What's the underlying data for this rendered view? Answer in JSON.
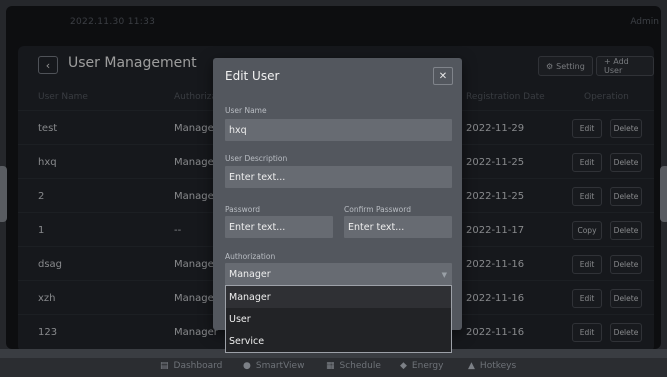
{
  "topbar": {
    "datetime": "2022.11.30   11:33",
    "user": "Admin"
  },
  "page": {
    "title": "User Management",
    "back_icon": "chevron-left-icon",
    "setting_label": "Setting",
    "add_user_label": "+ Add User"
  },
  "table": {
    "columns": [
      "User Name",
      "Authorizati",
      "Registration Date",
      "Operation"
    ],
    "rows": [
      {
        "name": "test",
        "auth": "Manager",
        "date": "2022-11-29",
        "btn1": "Edit",
        "btn2": "Delete"
      },
      {
        "name": "hxq",
        "auth": "Manager",
        "date": "2022-11-25",
        "btn1": "Edit",
        "btn2": "Delete"
      },
      {
        "name": "2",
        "auth": "Manager",
        "date": "2022-11-25",
        "btn1": "Edit",
        "btn2": "Delete"
      },
      {
        "name": "1",
        "auth": "--",
        "date": "2022-11-17",
        "btn1": "Copy",
        "btn2": "Delete"
      },
      {
        "name": "dsag",
        "auth": "Manager",
        "date": "2022-11-16",
        "btn1": "Edit",
        "btn2": "Delete"
      },
      {
        "name": "xzh",
        "auth": "Manager",
        "date": "2022-11-16",
        "btn1": "Edit",
        "btn2": "Delete"
      },
      {
        "name": "123",
        "auth": "Manager",
        "date": "2022-11-16",
        "btn1": "Edit",
        "btn2": "Delete"
      }
    ]
  },
  "dialog": {
    "title": "Edit User",
    "close_glyph": "✕",
    "username_label": "User Name",
    "username_value": "hxq",
    "description_label": "User Description",
    "description_placeholder": "Enter text...",
    "password_label": "Password",
    "password_placeholder": "Enter text...",
    "confirm_label": "Confirm Password",
    "confirm_placeholder": "Enter text...",
    "auth_label": "Authorization",
    "auth_value": "Manager",
    "auth_options": [
      "Manager",
      "User",
      "Service"
    ]
  },
  "nav": {
    "items": [
      {
        "label": "Dashboard",
        "icon": "dashboard-icon"
      },
      {
        "label": "SmartView",
        "icon": "smartview-icon"
      },
      {
        "label": "Schedule",
        "icon": "schedule-icon"
      },
      {
        "label": "Energy",
        "icon": "energy-icon"
      },
      {
        "label": "Hotkeys",
        "icon": "hotkeys-icon"
      }
    ]
  },
  "colors": {
    "background": "#14161a",
    "panel": "#22252b",
    "dialog": "#53575e",
    "field": "#676b72"
  }
}
